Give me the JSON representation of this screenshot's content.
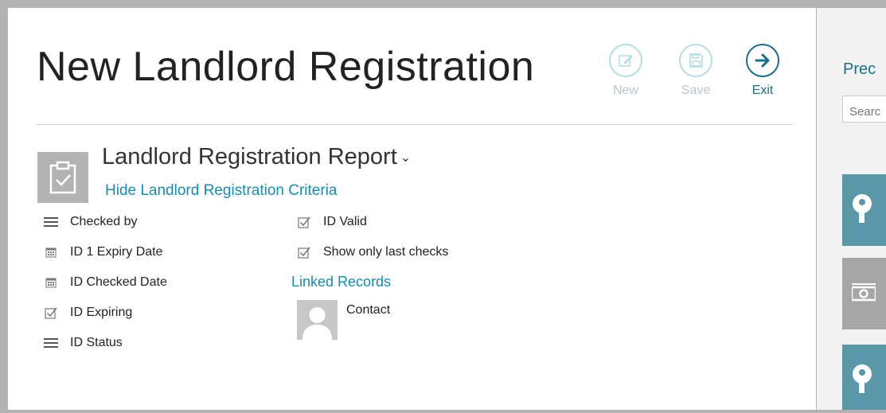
{
  "page": {
    "title": "New Landlord Registration"
  },
  "toolbar": {
    "new_label": "New",
    "save_label": "Save",
    "exit_label": "Exit"
  },
  "report": {
    "title": "Landlord Registration Report",
    "hide_criteria_link": "Hide Landlord Registration Criteria",
    "criteria_left": [
      {
        "label": "Checked by",
        "icon": "list-icon"
      },
      {
        "label": "ID 1 Expiry Date",
        "icon": "calendar-icon"
      },
      {
        "label": "ID Checked Date",
        "icon": "calendar-icon"
      },
      {
        "label": "ID Expiring",
        "icon": "checkbox-icon"
      },
      {
        "label": "ID Status",
        "icon": "list-icon"
      }
    ],
    "criteria_right": [
      {
        "label": "ID Valid",
        "icon": "checkbox-icon"
      },
      {
        "label": "Show only last checks",
        "icon": "checkbox-icon"
      }
    ],
    "linked_records_title": "Linked Records",
    "linked_records": [
      {
        "label": "Contact",
        "icon": "person-icon"
      }
    ]
  },
  "sidebar": {
    "title": "Prec",
    "search_placeholder": "Searc",
    "tiles": [
      {
        "icon": "key-icon",
        "color": "#5a98a8"
      },
      {
        "icon": "money-icon",
        "color": "#a6a6a6"
      },
      {
        "icon": "key-icon",
        "color": "#5a98a8"
      }
    ]
  },
  "colors": {
    "accent": "#1a8ab0",
    "exit": "#1c6c8c",
    "disabled": "#b5dde6",
    "frame": "#b3b3b3"
  }
}
